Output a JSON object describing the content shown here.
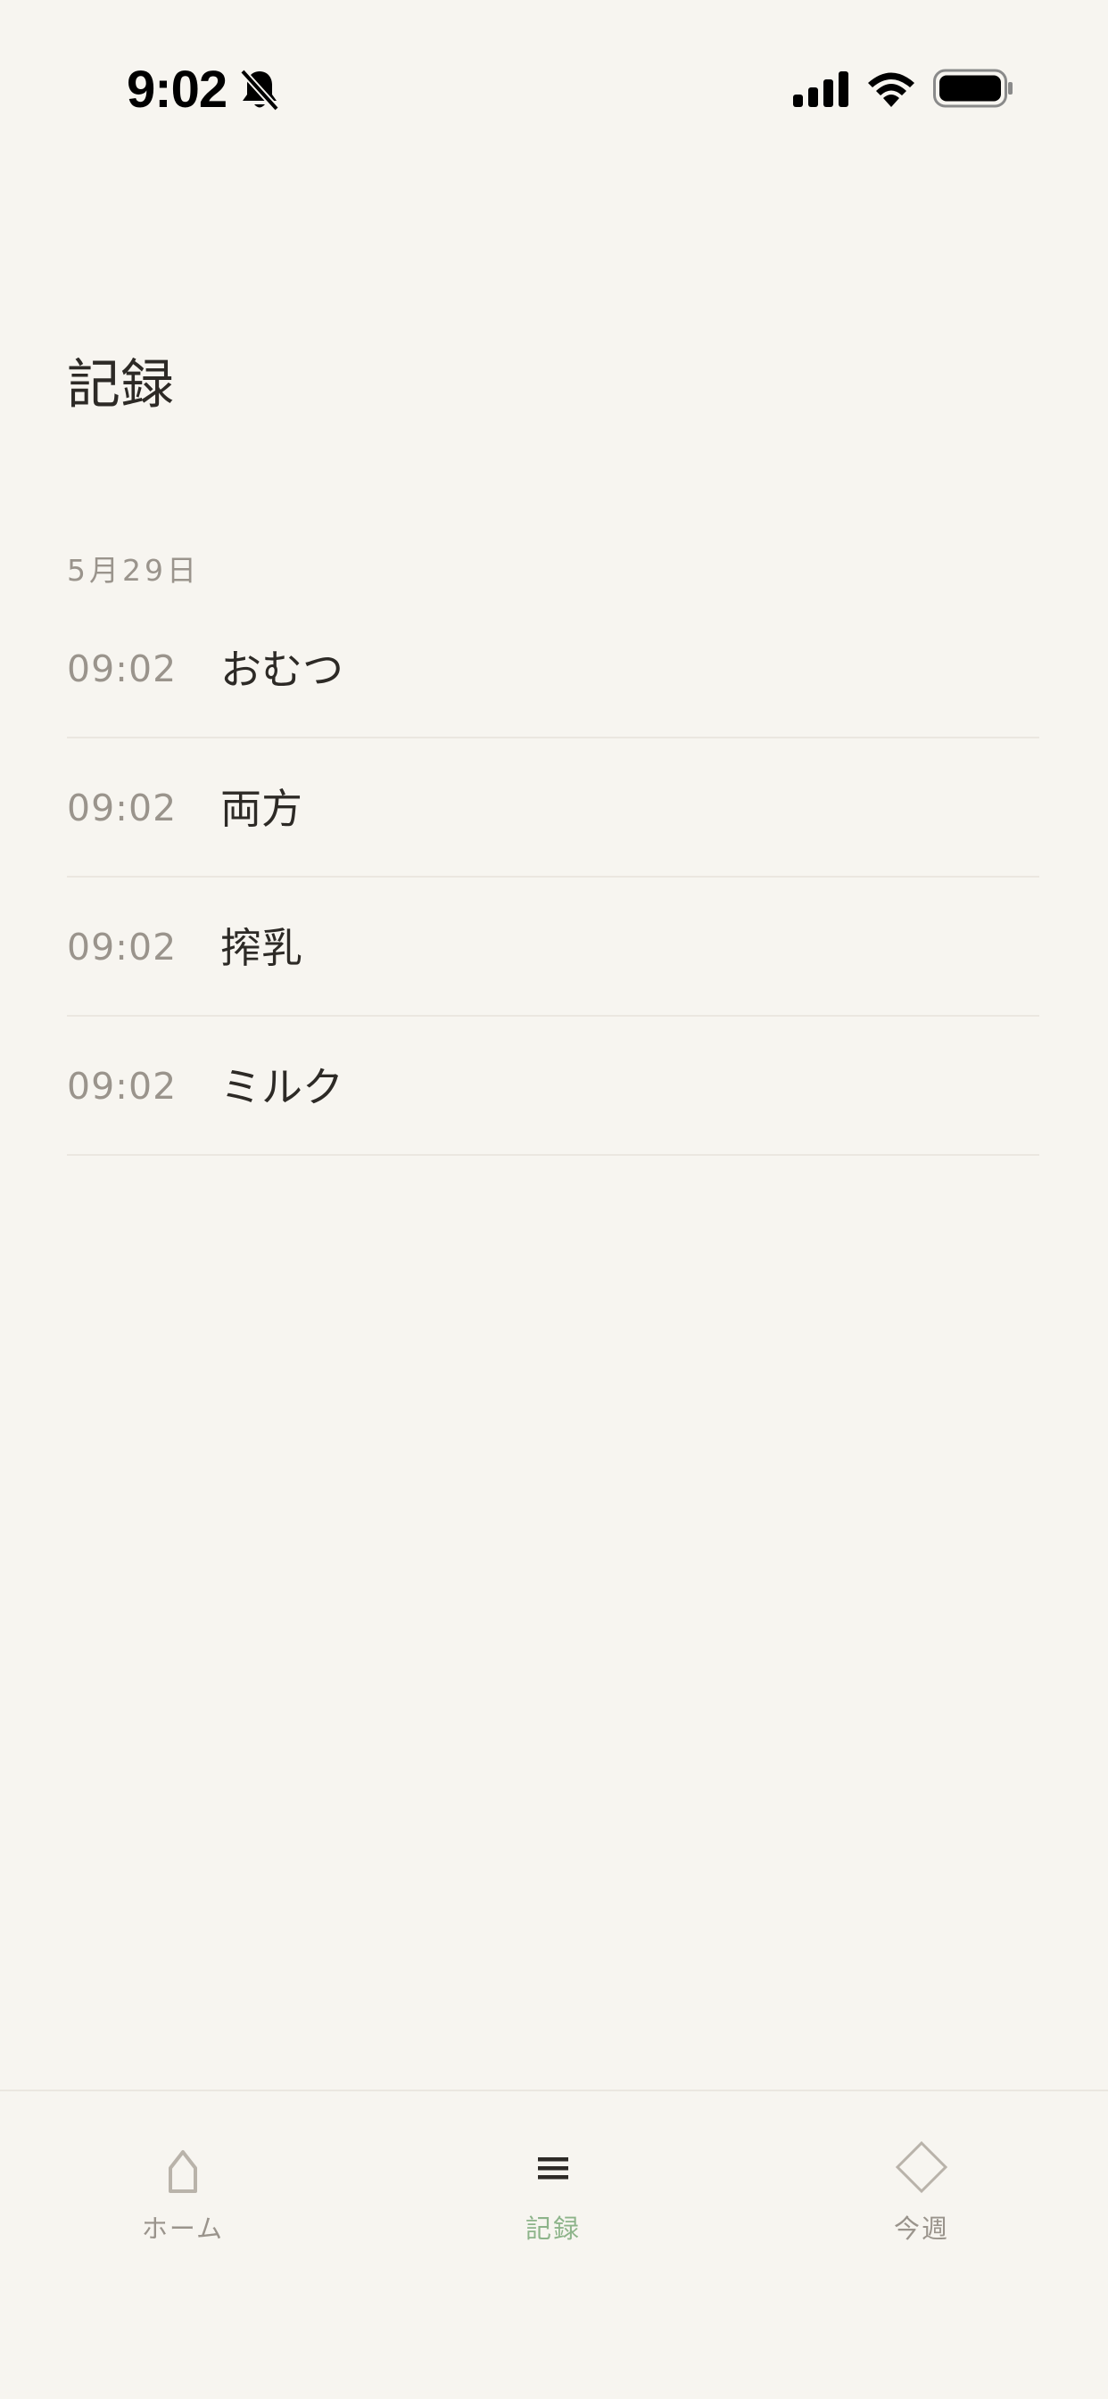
{
  "status_bar": {
    "time": "9:02",
    "icons": [
      "bell-slash-icon",
      "cellular-signal-icon",
      "wifi-icon",
      "battery-icon"
    ]
  },
  "page": {
    "title": "記録"
  },
  "records": {
    "date": "5月29日",
    "items": [
      {
        "time": "09:02",
        "label": "おむつ"
      },
      {
        "time": "09:02",
        "label": "両方"
      },
      {
        "time": "09:02",
        "label": "搾乳"
      },
      {
        "time": "09:02",
        "label": "ミルク"
      }
    ]
  },
  "tab_bar": {
    "tabs": [
      {
        "label": "ホーム",
        "icon": "home-icon",
        "active": false
      },
      {
        "label": "記録",
        "icon": "list-icon",
        "active": true
      },
      {
        "label": "今週",
        "icon": "diamond-icon",
        "active": false
      }
    ]
  },
  "colors": {
    "background": "#f7f5f0",
    "text_primary": "#2d2a26",
    "text_secondary": "#9a948c",
    "accent": "#8db48a",
    "divider": "#ebe7e0"
  }
}
